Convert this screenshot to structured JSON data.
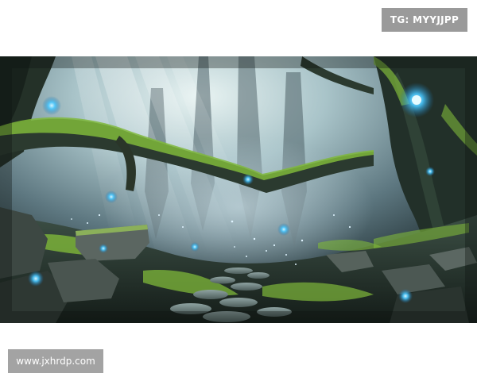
{
  "watermarks": {
    "tag_label": "TG: MYYJJPP",
    "url_label": "www.jxhrdp.com"
  },
  "scene": {
    "subject": "mystical-forest-illustration",
    "colors": {
      "page_background": "#ffffff",
      "badge_background": "#9a9a9a",
      "badge_text": "#ffffff",
      "glow": "#49c8ff",
      "moss": "#7fb83a",
      "fog": "#b9cdd6",
      "dark_bark": "#1f2b26"
    }
  }
}
